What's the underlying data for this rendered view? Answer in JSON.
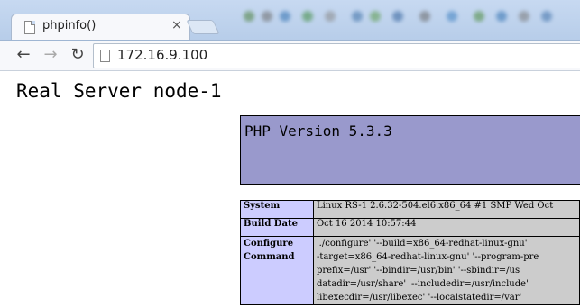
{
  "browser": {
    "tab_title": "phpinfo()",
    "tab_close": "×",
    "back": "←",
    "forward": "→",
    "reload": "↻",
    "url": "172.16.9.100"
  },
  "page": {
    "title": "Real Server node-1",
    "php_version": "PHP Version 5.3.3",
    "rows": [
      {
        "key": "System",
        "value": "Linux RS-1 2.6.32-504.el6.x86_64 #1 SMP Wed Oct"
      },
      {
        "key": "Build Date",
        "value": "Oct 16 2014 10:57:44"
      },
      {
        "key": "Configure Command",
        "lines": [
          "'./configure' '--build=x86_64-redhat-linux-gnu'",
          "-target=x86_64-redhat-linux-gnu' '--program-pre",
          "prefix=/usr' '--bindir=/usr/bin' '--sbindir=/us",
          "datadir=/usr/share' '--includedir=/usr/include'",
          "libexecdir=/usr/libexec' '--localstatedir=/var'"
        ]
      }
    ]
  }
}
